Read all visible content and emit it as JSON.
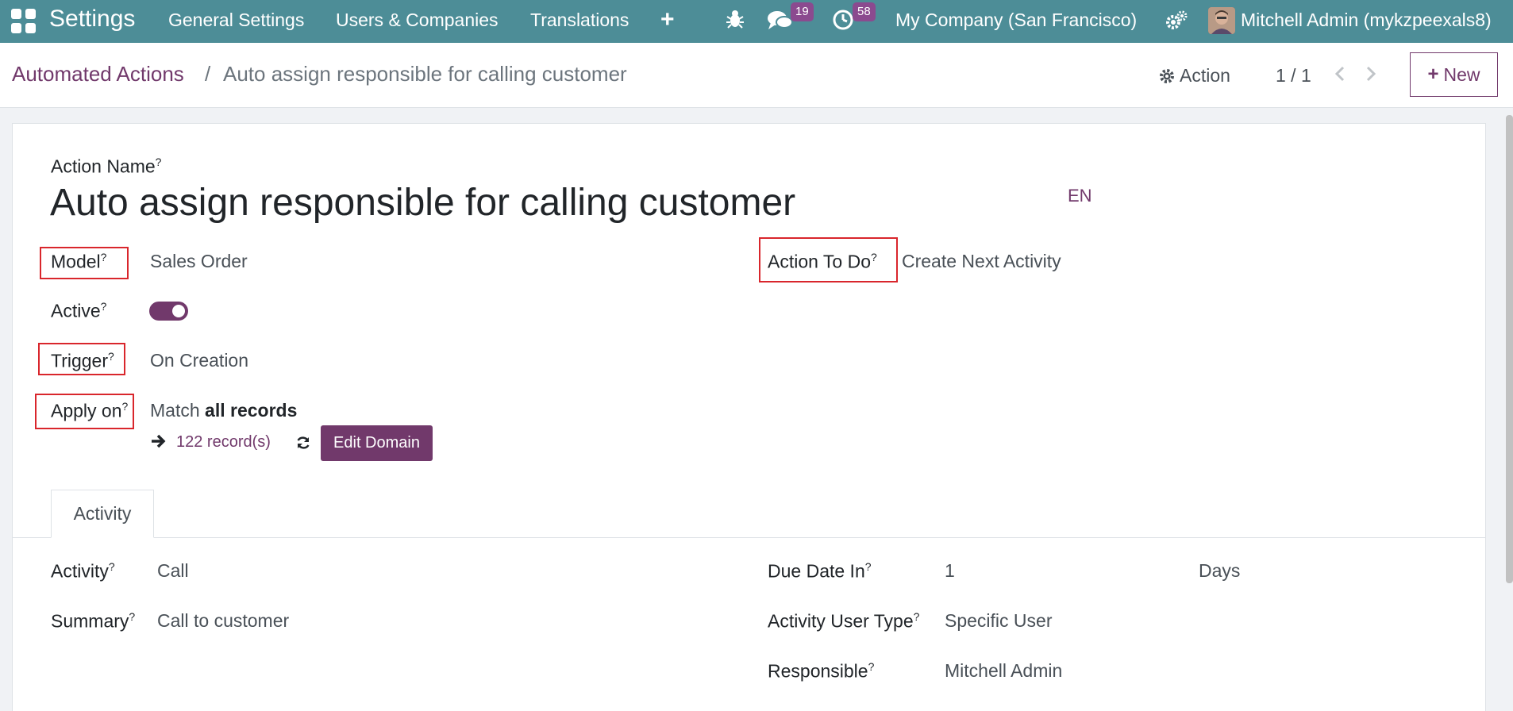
{
  "navbar": {
    "brand": "Settings",
    "menu": [
      "General Settings",
      "Users & Companies",
      "Translations"
    ],
    "messages_count": "19",
    "activities_count": "58",
    "company": "My Company (San Francisco)",
    "user": "Mitchell Admin (mykzpeexals8)"
  },
  "breadcrumb": {
    "parent": "Automated Actions",
    "separator": "/",
    "current": "Auto assign responsible for calling customer"
  },
  "control": {
    "action_label": "Action",
    "pager": "1 / 1",
    "new_label": "New"
  },
  "form": {
    "action_name_label": "Action Name",
    "action_name": "Auto assign responsible for calling customer",
    "lang": "EN",
    "help_mark": "?",
    "model_label": "Model",
    "model_value": "Sales Order",
    "active_label": "Active",
    "active": true,
    "trigger_label": "Trigger",
    "trigger_value": "On Creation",
    "apply_on_label": "Apply on",
    "apply_on_prefix": "Match",
    "apply_on_value": "all records",
    "records_link": "122 record(s)",
    "edit_domain_label": "Edit Domain",
    "action_to_do_label": "Action To Do",
    "action_to_do_value": "Create Next Activity"
  },
  "tabs": {
    "active": "Activity"
  },
  "activity": {
    "activity_label": "Activity",
    "activity_value": "Call",
    "summary_label": "Summary",
    "summary_value": "Call to customer",
    "due_date_label": "Due Date In",
    "due_date_value": "1",
    "due_date_unit": "Days",
    "user_type_label": "Activity User Type",
    "user_type_value": "Specific User",
    "responsible_label": "Responsible",
    "responsible_value": "Mitchell Admin"
  },
  "colors": {
    "navbar": "#4d8d97",
    "primary": "#71396b",
    "highlight": "#d9262c"
  }
}
